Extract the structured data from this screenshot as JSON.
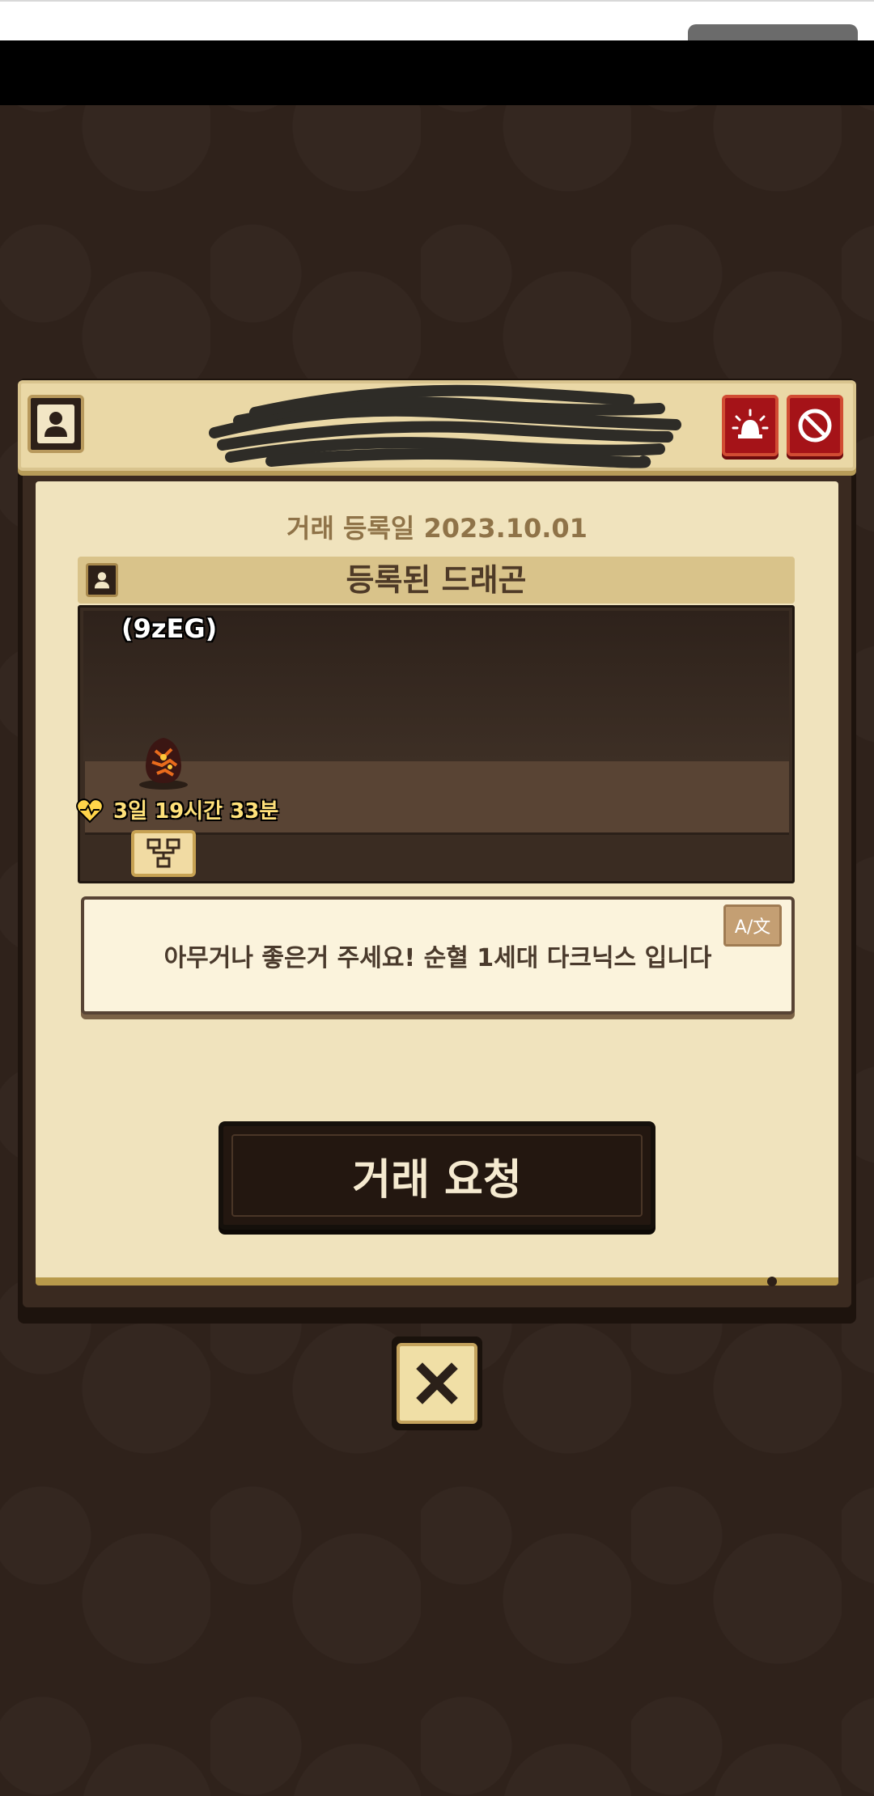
{
  "header": {
    "report_icon": "siren-icon",
    "block_icon": "block-icon",
    "profile_icon": "person-icon"
  },
  "trade": {
    "registration_date": "거래 등록일 2023.10.01",
    "section_title": "등록된 드래곤",
    "dragon_name": "(9zEG)",
    "time_remaining": "3일 19시간 33분",
    "message": "아무거나 좋은거 주세요! 순혈 1세대 다크닉스 입니다",
    "translate_label": "A/文",
    "request_button": "거래 요청"
  },
  "colors": {
    "background": "#2f221b",
    "panel": "#f0e3bd",
    "accent_red": "#a51318",
    "gold_text": "#ffe17a"
  }
}
